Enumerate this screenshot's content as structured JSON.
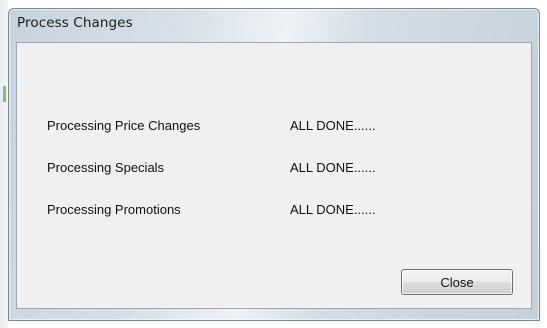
{
  "window": {
    "title": "Process Changes"
  },
  "rows": [
    {
      "label": "Processing Price Changes",
      "status": "ALL DONE......"
    },
    {
      "label": "Processing Specials",
      "status": "ALL DONE......"
    },
    {
      "label": "Processing Promotions",
      "status": "ALL DONE......"
    }
  ],
  "buttons": {
    "close_label": "Close"
  }
}
